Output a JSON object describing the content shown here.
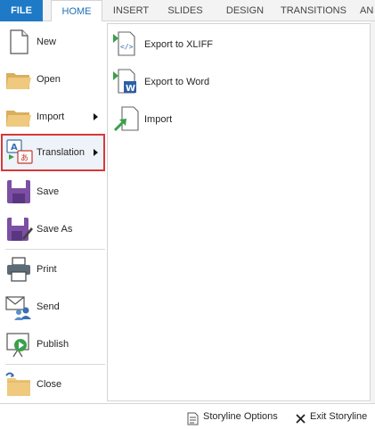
{
  "ribbon": {
    "tabs": [
      {
        "label": "FILE"
      },
      {
        "label": "HOME"
      },
      {
        "label": "INSERT"
      },
      {
        "label": "SLIDES"
      },
      {
        "label": "DESIGN"
      },
      {
        "label": "TRANSITIONS"
      },
      {
        "label": "AN"
      }
    ]
  },
  "file_menu": {
    "items": [
      {
        "label": "New",
        "icon": "new-file-icon"
      },
      {
        "label": "Open",
        "icon": "open-folder-icon"
      },
      {
        "label": "Import",
        "icon": "import-folder-icon"
      },
      {
        "label": "Translation",
        "icon": "translation-icon",
        "selected": true
      },
      {
        "label": "Save",
        "icon": "save-icon"
      },
      {
        "label": "Save As",
        "icon": "save-as-icon"
      },
      {
        "label": "Print",
        "icon": "print-icon"
      },
      {
        "label": "Send",
        "icon": "send-icon"
      },
      {
        "label": "Publish",
        "icon": "publish-icon"
      },
      {
        "label": "Close",
        "icon": "close-folder-icon"
      }
    ]
  },
  "translation_submenu": {
    "items": [
      {
        "label": "Export to XLIFF",
        "icon": "export-xliff-icon"
      },
      {
        "label": "Export to Word",
        "icon": "export-word-icon"
      },
      {
        "label": "Import",
        "icon": "import-translation-icon"
      }
    ]
  },
  "bottom_bar": {
    "storyline_options": "Storyline Options",
    "exit_storyline": "Exit Storyline"
  },
  "colors": {
    "file_tab": "#1e7ac7",
    "selection_border": "#d9383a",
    "save_purple": "#7b4fa3",
    "folder_tan": "#e8c57a"
  }
}
